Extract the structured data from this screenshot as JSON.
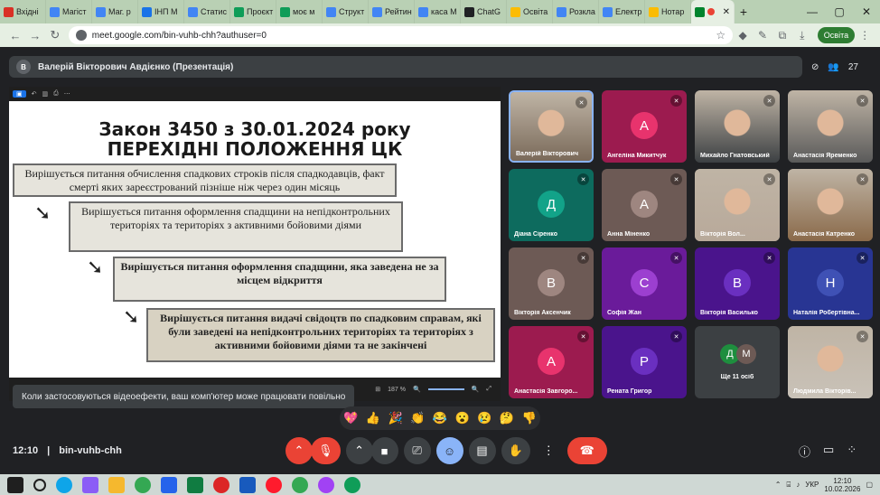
{
  "browser": {
    "tabs": [
      {
        "label": "Вхідні",
        "color": "#d93025"
      },
      {
        "label": "Магіст",
        "color": "#4285f4"
      },
      {
        "label": "Маг. р",
        "color": "#4285f4"
      },
      {
        "label": "ІНП М",
        "color": "#1a73e8"
      },
      {
        "label": "Статис",
        "color": "#4285f4"
      },
      {
        "label": "Проєкт",
        "color": "#0f9d58"
      },
      {
        "label": "моє м",
        "color": "#0f9d58"
      },
      {
        "label": "Структ",
        "color": "#4285f4"
      },
      {
        "label": "Рейтин",
        "color": "#4285f4"
      },
      {
        "label": "каса М",
        "color": "#4285f4"
      },
      {
        "label": "ChatG",
        "color": "#202124"
      },
      {
        "label": "Освіта",
        "color": "#fbbc04"
      },
      {
        "label": "Розкла",
        "color": "#4285f4"
      },
      {
        "label": "Електр",
        "color": "#4285f4"
      },
      {
        "label": "Нотар",
        "color": "#fbbc04"
      }
    ],
    "active_tab_close": "✕",
    "new_tab": "+",
    "url": "meet.google.com/bin-vuhb-chh?authuser=0",
    "profile": "Освіта"
  },
  "meet": {
    "presenter_initial": "В",
    "presenter_title": "Валерій Вікторович Авдієнко (Презентація)",
    "participant_count": "27",
    "slide": {
      "title1": "Закон 3450 з 30.01.2024 року",
      "title2": "ПЕРЕХІДНІ ПОЛОЖЕННЯ ЦК",
      "box1": "Вирішується питання обчислення спадкових строків після спадкодавців, факт смерті яких зареєстрований пізніше ніж через один місяць",
      "box2": "Вирішується питання оформлення спадщини на непідконтрольних територіях та територіях з активними бойовими діями",
      "box3": "Вирішується питання оформлення спадщини, яка заведена не за місцем відкриття",
      "box4": "Вирішується питання видачі свідоцтв по спадковим справам, які були заведені на непідконтрольних територіях та територіях з активними бойовими діями та не закінчені"
    },
    "viewer_zoom": "187 %",
    "toast": "Коли застосовуються відеоефекти, ваш комп'ютер може працювати повільно",
    "tiles": [
      {
        "name": "Валерій Вікторович",
        "initial": "",
        "bg": "#7a6a5a"
      },
      {
        "name": "Ангеліна Микитчук",
        "initial": "А",
        "bg": "#9c1b4f",
        "ic": "#e8336d"
      },
      {
        "name": "Михайло Гнатовський",
        "initial": "",
        "bg": "#3c4043"
      },
      {
        "name": "Анастасія Яременко",
        "initial": "",
        "bg": "#5a5a5a"
      },
      {
        "name": "Діана Сіренко",
        "initial": "Д",
        "bg": "#0d6b5e",
        "ic": "#12a389"
      },
      {
        "name": "Анна Міненко",
        "initial": "А",
        "bg": "#6d5a55",
        "ic": "#9e8680"
      },
      {
        "name": "Вікторія Вол...",
        "initial": "",
        "bg": "#b8a99a"
      },
      {
        "name": "Анастасія Катренко",
        "initial": "",
        "bg": "#8a6a4a"
      },
      {
        "name": "Вікторія Аксенчик",
        "initial": "В",
        "bg": "#6d5a55",
        "ic": "#9e8680"
      },
      {
        "name": "Софія Жан",
        "initial": "С",
        "bg": "#6a1b9a",
        "ic": "#9c3fd0"
      },
      {
        "name": "Вікторія Василько",
        "initial": "В",
        "bg": "#4a148c",
        "ic": "#6a2fc0"
      },
      {
        "name": "Наталія Робертівна...",
        "initial": "Н",
        "bg": "#283593",
        "ic": "#3f51b5"
      },
      {
        "name": "Анастасія Завгоро...",
        "initial": "А",
        "bg": "#9c1b4f",
        "ic": "#e8336d"
      },
      {
        "name": "Рената Григор",
        "initial": "Р",
        "bg": "#4a148c",
        "ic": "#6a2fc0"
      },
      {
        "name": "Ще 11 осіб",
        "initial": "",
        "bg": "#3c4043"
      },
      {
        "name": "Людмила Вікторів...",
        "initial": "",
        "bg": "#c9c2b8"
      }
    ],
    "others": {
      "label": "Ще 11 осіб",
      "a": "Д",
      "b": "М"
    },
    "emojis": [
      "💖",
      "👍",
      "🎉",
      "👏",
      "😂",
      "😮",
      "😢",
      "🤔",
      "👎"
    ],
    "time": "12:10",
    "meeting_code": "bin-vuhb-chh"
  },
  "taskbar": {
    "lang": "УКР",
    "time": "12:10",
    "date": "10.02.2026"
  }
}
